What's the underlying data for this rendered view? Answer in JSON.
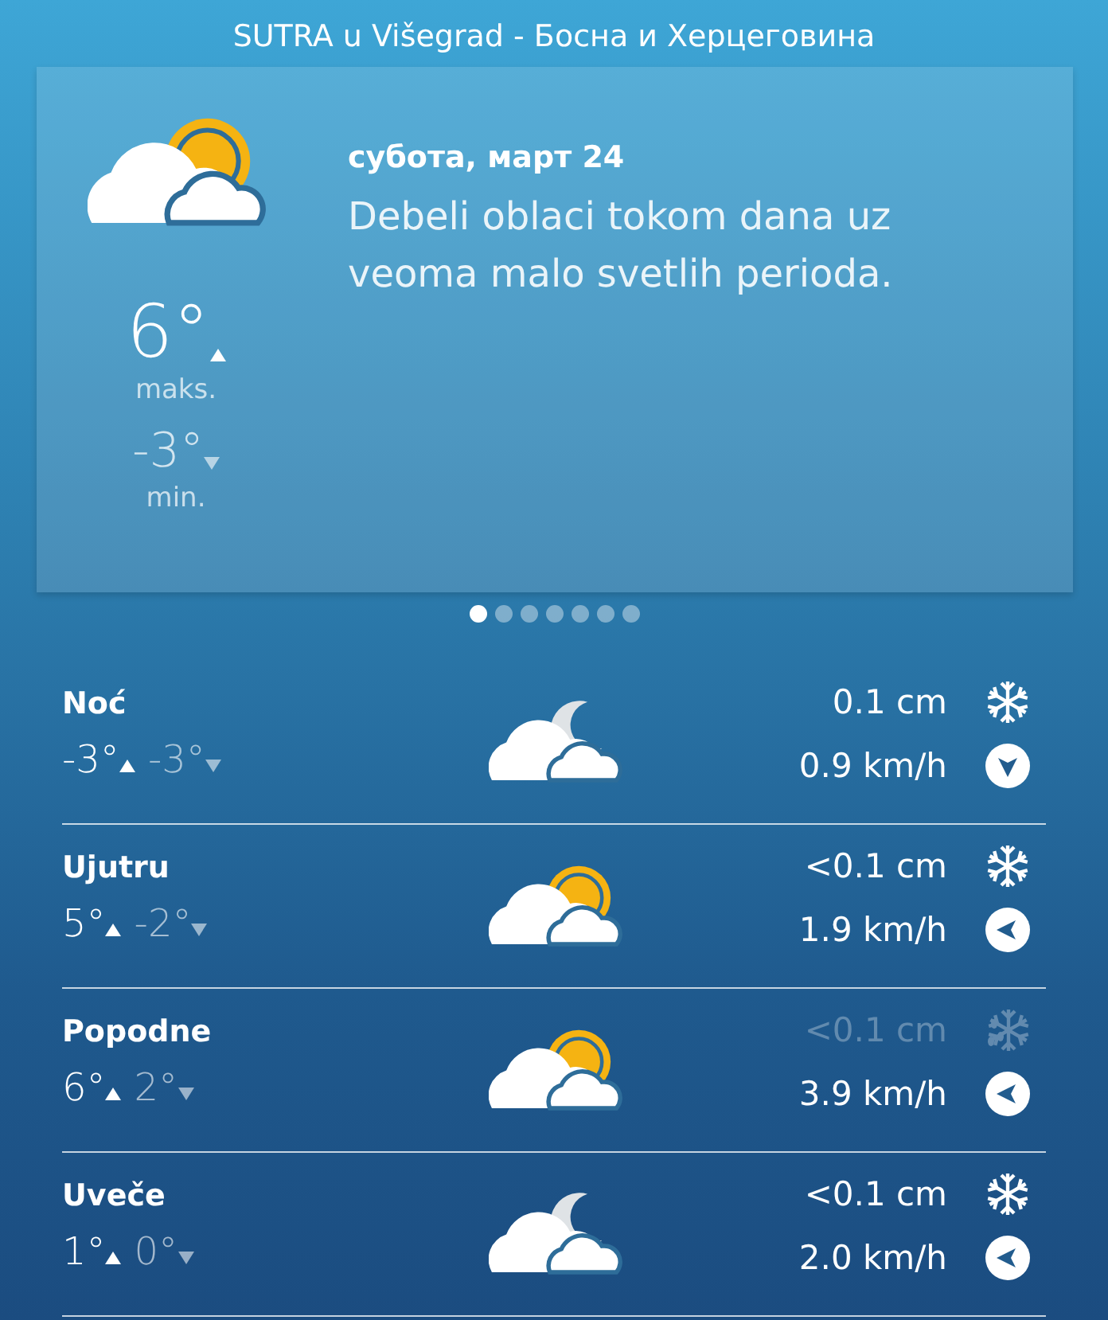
{
  "header": {
    "title": "SUTRA u Višegrad - Босна и Херцеговина"
  },
  "summary": {
    "sky": {
      "kind": "sun"
    },
    "date": "субота, март 24",
    "description": "Debeli oblaci tokom dana uz veoma malo svetlih perioda.",
    "max": "6°",
    "max_label": "maks.",
    "min": "-3°",
    "min_label": "min."
  },
  "pager": [
    {
      "selected": true
    },
    {
      "selected": false
    },
    {
      "selected": false
    },
    {
      "selected": false
    },
    {
      "selected": false
    },
    {
      "selected": false
    },
    {
      "selected": false
    }
  ],
  "periods": [
    {
      "name": "Noć",
      "max": "-3°",
      "min": "-3°",
      "sky": {
        "kind": "moon"
      },
      "precipitation": "0.1 cm",
      "precip_icon": {
        "kind": "snow"
      },
      "dimmed": false,
      "wind": "0.9 km/h",
      "wind_arrow": {
        "kind": "down"
      }
    },
    {
      "name": "Ujutru",
      "max": "5°",
      "min": "-2°",
      "sky": {
        "kind": "sun"
      },
      "precipitation": "<0.1 cm",
      "precip_icon": {
        "kind": "snow"
      },
      "dimmed": false,
      "wind": "1.9 km/h",
      "wind_arrow": {
        "kind": "left"
      }
    },
    {
      "name": "Popodne",
      "max": "6°",
      "min": "2°",
      "sky": {
        "kind": "sun"
      },
      "precipitation": "<0.1 cm",
      "precip_icon": {
        "kind": "mixed"
      },
      "dimmed": true,
      "wind": "3.9 km/h",
      "wind_arrow": {
        "kind": "left"
      }
    },
    {
      "name": "Uveče",
      "max": "1°",
      "min": "0°",
      "sky": {
        "kind": "moon"
      },
      "precipitation": "<0.1 cm",
      "precip_icon": {
        "kind": "snow"
      },
      "dimmed": false,
      "wind": "2.0 km/h",
      "wind_arrow": {
        "kind": "left"
      }
    }
  ]
}
